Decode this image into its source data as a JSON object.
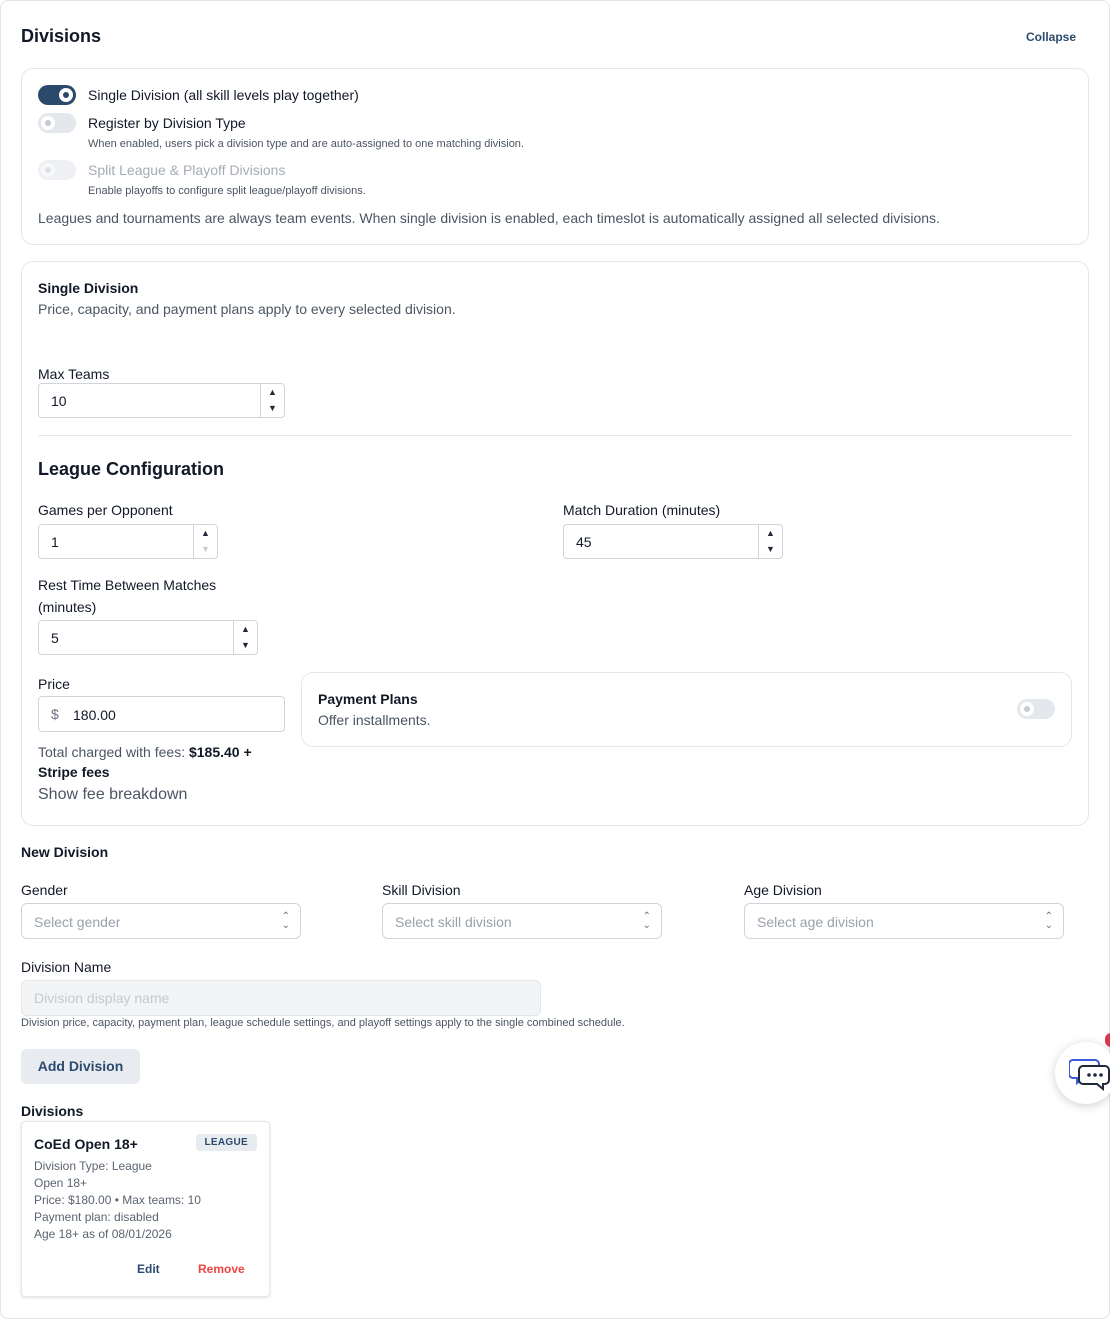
{
  "header": {
    "title": "Divisions",
    "collapse_label": "Collapse"
  },
  "division_mode": {
    "single_division": {
      "label": "Single Division (all skill levels play together)",
      "enabled": true
    },
    "register_by_type": {
      "label": "Register by Division Type",
      "hint": "When enabled, users pick a division type and are auto-assigned to one matching division.",
      "enabled": false
    },
    "split_league": {
      "label": "Split League & Playoff Divisions",
      "hint": "Enable playoffs to configure split league/playoff divisions.",
      "enabled": false,
      "disabled": true
    },
    "note": "Leagues and tournaments are always team events. When single division is enabled, each timeslot is automatically assigned all selected divisions."
  },
  "single_division": {
    "title": "Single Division",
    "description": "Price, capacity, and payment plans apply to every selected division.",
    "max_teams": {
      "label": "Max Teams",
      "value": "10"
    }
  },
  "league_config": {
    "title": "League Configuration",
    "games_per_opponent": {
      "label": "Games per Opponent",
      "value": "1"
    },
    "match_duration": {
      "label": "Match Duration (minutes)",
      "value": "45"
    },
    "rest_time": {
      "label_line1": "Rest Time Between Matches",
      "label_line2": "(minutes)",
      "value": "5"
    }
  },
  "pricing": {
    "label": "Price",
    "currency_symbol": "$",
    "value": "180.00",
    "total_prefix": "Total charged with fees: ",
    "total_amount": "$185.40 +",
    "total_suffix": "Stripe fees",
    "fee_breakdown_link": "Show fee breakdown"
  },
  "payment_plans": {
    "title": "Payment Plans",
    "description": "Offer installments.",
    "enabled": false
  },
  "new_division": {
    "title": "New Division",
    "gender": {
      "label": "Gender",
      "placeholder": "Select gender"
    },
    "skill": {
      "label": "Skill Division",
      "placeholder": "Select skill division"
    },
    "age": {
      "label": "Age Division",
      "placeholder": "Select age division"
    },
    "name": {
      "label": "Division Name",
      "placeholder": "Division display name"
    },
    "help": "Division price, capacity, payment plan, league schedule settings, and playoff settings apply to the single combined schedule.",
    "add_button": "Add Division"
  },
  "divisions_list": {
    "title": "Divisions",
    "items": [
      {
        "name": "CoEd Open 18+",
        "badge": "LEAGUE",
        "type": "Division Type: League",
        "level": "Open 18+",
        "price_capacity": "Price: $180.00 • Max teams: 10",
        "payment_plan": "Payment plan: disabled",
        "age": "Age 18+ as of 08/01/2026",
        "edit_label": "Edit",
        "remove_label": "Remove"
      }
    ]
  },
  "icons": {
    "chat": "chat-support-icon",
    "chevron_up": "▲",
    "chevron_down": "▼"
  },
  "colors": {
    "primary": "#2b4a6b",
    "danger": "#ef4444",
    "notification": "#d9354f"
  }
}
